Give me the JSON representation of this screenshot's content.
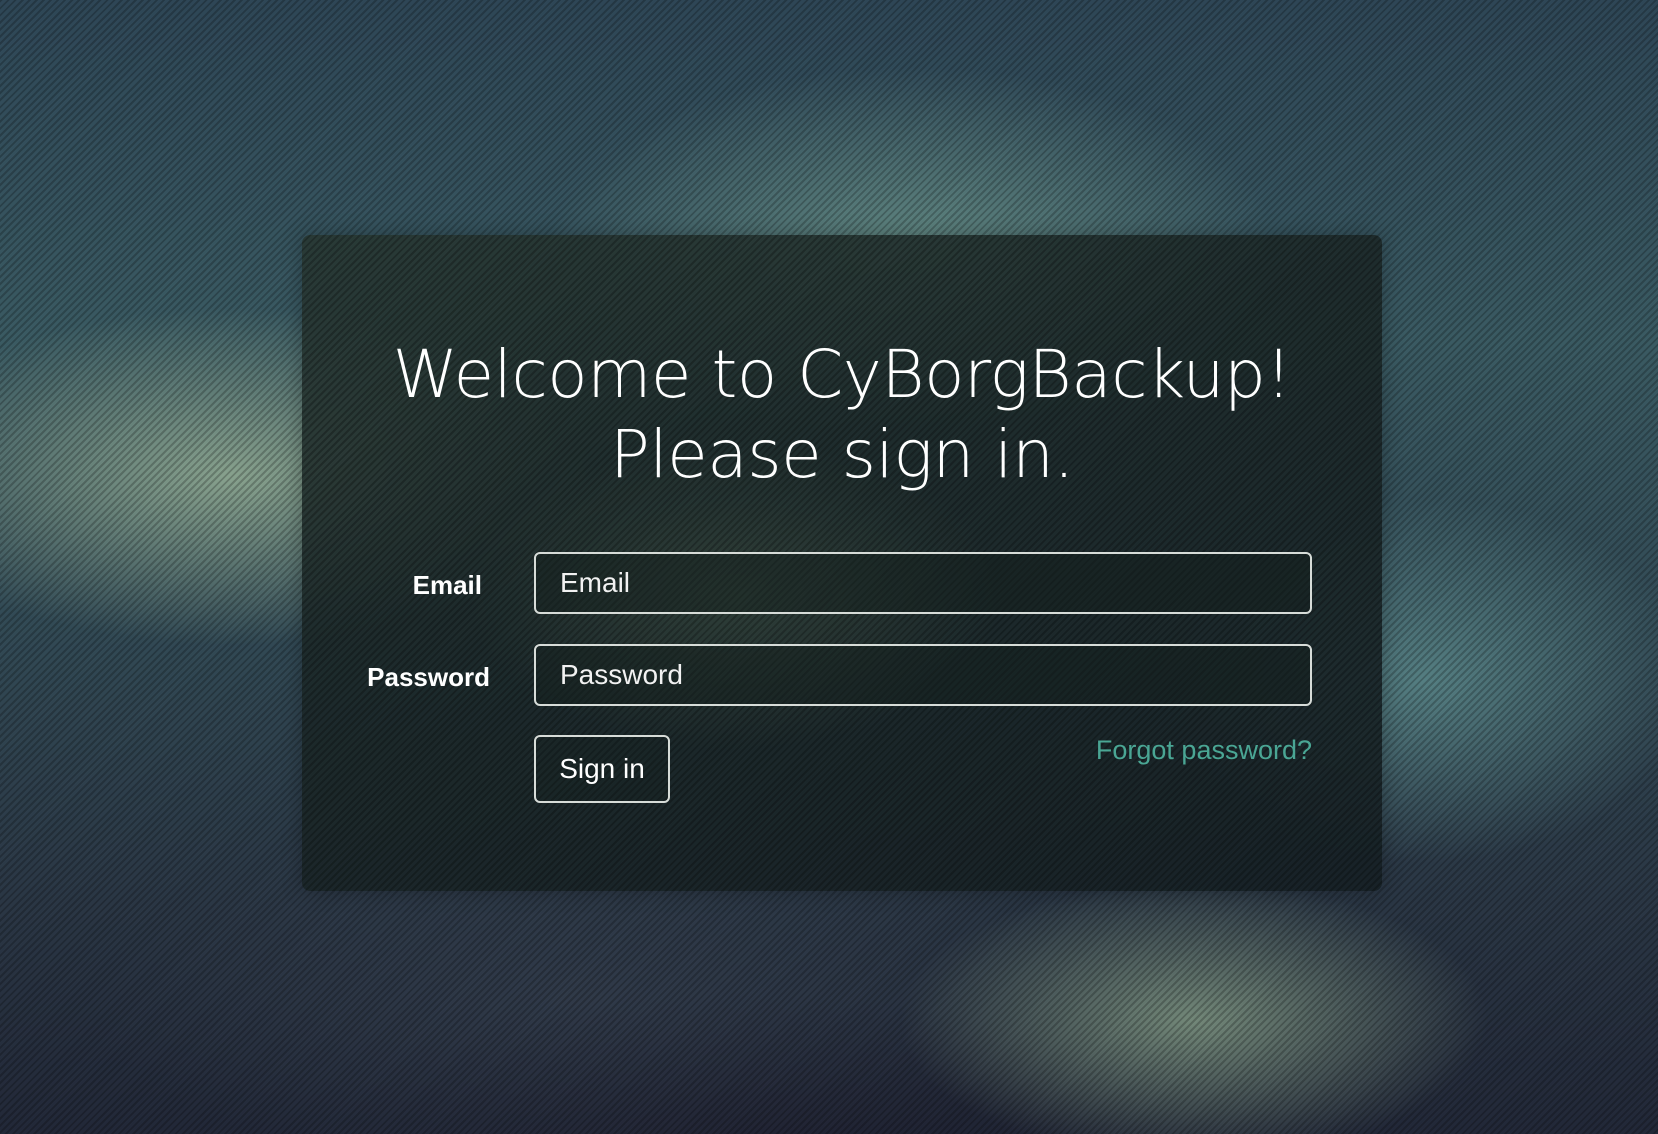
{
  "login": {
    "title_line1": "Welcome to CyBorgBackup!",
    "title_line2": "Please sign in.",
    "email_label": "Email",
    "email_placeholder": "Email",
    "email_value": "",
    "password_label": "Password",
    "password_placeholder": "Password",
    "password_value": "",
    "signin_label": "Sign in",
    "forgot_label": "Forgot password?"
  },
  "colors": {
    "link": "#4aa694",
    "border": "#d7dcd8",
    "text": "#ffffff"
  }
}
